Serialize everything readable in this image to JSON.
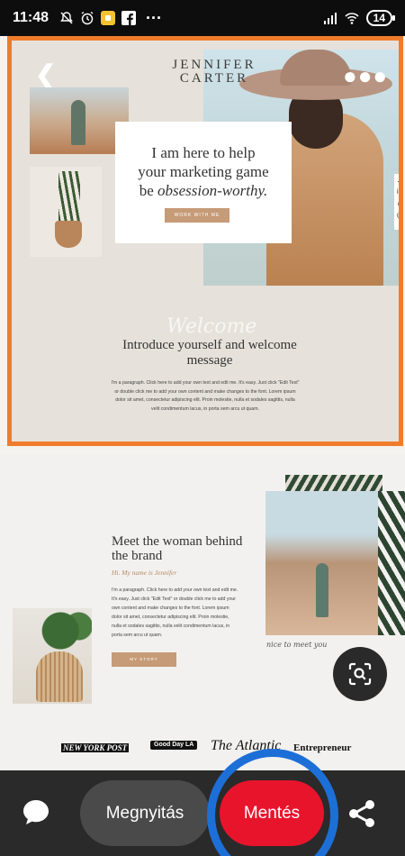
{
  "status_bar": {
    "time": "11:48",
    "more": "···",
    "battery": "14",
    "icons": [
      "mute-bell-icon",
      "alarm-icon",
      "yellow-app-icon",
      "facebook-icon",
      "signal-icon",
      "wifi-icon"
    ]
  },
  "preview_top": {
    "brand": "JENNIFER CARTER",
    "hero_heading_1": "I am here to help",
    "hero_heading_2": "your marketing game",
    "hero_heading_3a": "be ",
    "hero_heading_3b": "obsession-worthy.",
    "hero_button": "WORK WITH ME",
    "intro_script": "Welcome",
    "intro_title": "Introduce yourself and welcome message",
    "intro_paragraph": "I'm a paragraph. Click here to add your own text and edit me. It's easy. Just click \"Edit Text\" or double click me to add your own content and make changes to the font. Lorem ipsum dolor sit amet, consectetur adipiscing elit. Proin molestie, nulla et sodales sagittis, nulla velit condimentum lacus, in porta sem arcu ut quam.",
    "side_icons": [
      "♫",
      "in",
      "a",
      "◎"
    ],
    "accent_color": "#c69b77",
    "selection_color": "#f07c2b"
  },
  "preview_bottom": {
    "meet_title": "Meet the woman behind the brand",
    "meet_subtitle": "Hi. My name is Jennifer",
    "meet_paragraph": "I'm a paragraph. Click here to add your own text and edit me. It's easy. Just click \"Edit Text\" or double click me to add your own content and make changes to the font. Lorem ipsum dolor sit amet, consectetur adipiscing elit. Proin molestie, nulla et sodales sagittis, nulla velit condimentum lacus, in porta sem arcu ut quam.",
    "story_button": "MY STORY",
    "nice_script": "nice to meet you",
    "logos": {
      "nyp": "NEW YORK POST",
      "gdla": "Good Day LA",
      "atlantic": "The Atlantic",
      "entrepreneur": "Entrepreneur"
    }
  },
  "bottom_bar": {
    "open_label": "Megnyitás",
    "save_label": "Mentés",
    "save_color": "#e8142c",
    "highlight_ring_color": "#1d6fd8"
  }
}
